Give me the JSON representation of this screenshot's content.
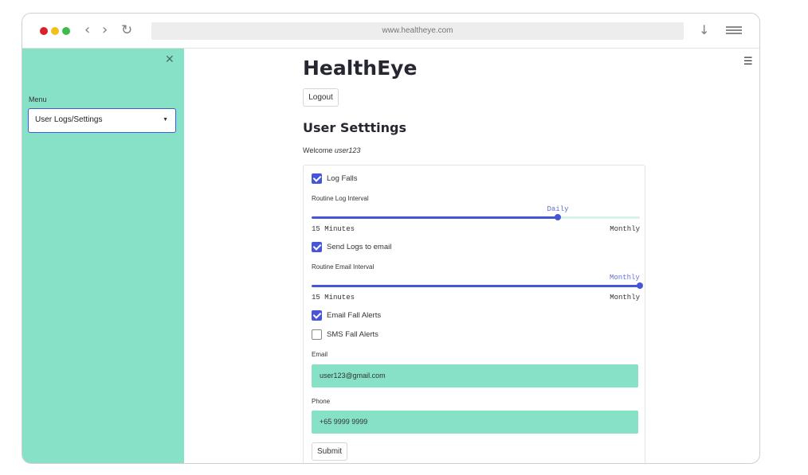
{
  "browser": {
    "url": "www.healtheye.com"
  },
  "sidebar": {
    "menu_label": "Menu",
    "selected_page": "User Logs/Settings"
  },
  "main": {
    "title": "HealthEye",
    "logout_label": "Logout",
    "subtitle": "User Setttings",
    "welcome_prefix": "Welcome",
    "username": "user123",
    "form": {
      "log_falls": {
        "label": "Log Falls",
        "checked": true
      },
      "routine_log_interval": {
        "label": "Routine Log Interval",
        "value": "Daily",
        "level": 0.75,
        "min_label": "15 Minutes",
        "max_label": "Monthly"
      },
      "send_logs_email": {
        "label": "Send Logs to email",
        "checked": true
      },
      "routine_email_interval": {
        "label": "Routine Email Interval",
        "value": "Monthly",
        "level": 1.0,
        "min_label": "15 Minutes",
        "max_label": "Monthly"
      },
      "email_fall_alerts": {
        "label": "Email Fall Alerts",
        "checked": true
      },
      "sms_fall_alerts": {
        "label": "SMS Fall Alerts",
        "checked": false
      },
      "email": {
        "label": "Email",
        "value": "user123@gmail.com"
      },
      "phone": {
        "label": "Phone",
        "value": "+65 9999 9999"
      },
      "submit_label": "Submit"
    }
  },
  "colors": {
    "sidebar_bg": "#86e1c6",
    "accent": "#4756d8",
    "input_bg": "#86e1c6"
  }
}
